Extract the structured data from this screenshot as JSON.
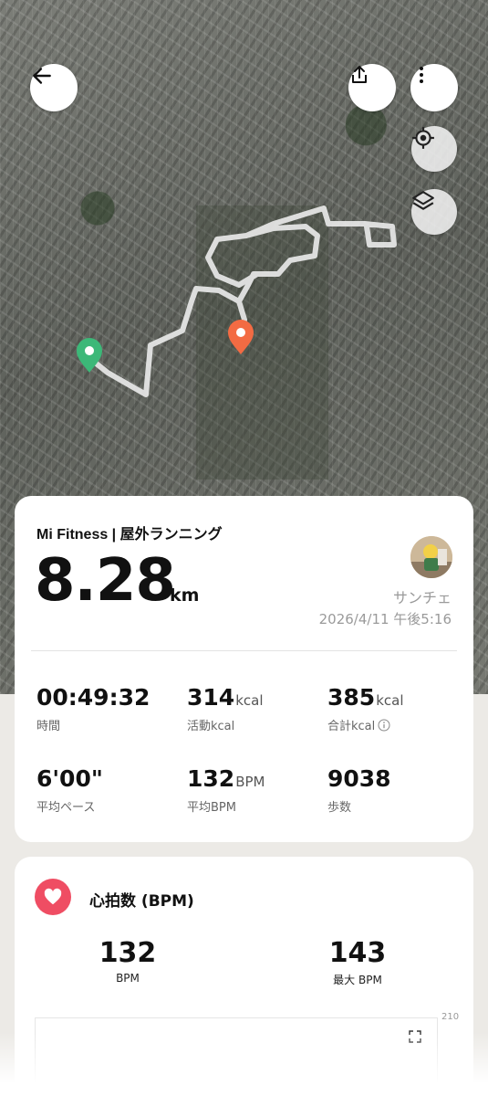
{
  "toolbar": {
    "back": "back-icon",
    "share": "share-icon",
    "more": "more-vertical-icon",
    "locate": "crosshair-icon",
    "layers": "layers-icon"
  },
  "map": {
    "route_color": "#e8e8e8",
    "start_marker_color": "#3cb878",
    "end_marker_color": "#f36b43"
  },
  "summary": {
    "source": "Mi Fitness | 屋外ランニング",
    "distance": "8.28",
    "distance_unit": "km",
    "username": "サンチェ",
    "datetime": "2026/4/11 午後5:16",
    "metrics": [
      {
        "value": "00:49:32",
        "unit": "",
        "label": "時間"
      },
      {
        "value": "314",
        "unit": "kcal",
        "label": "活動kcal"
      },
      {
        "value": "385",
        "unit": "kcal",
        "label": "合計kcal"
      },
      {
        "value": "6'00\"",
        "unit": "",
        "label": "平均ペース"
      },
      {
        "value": "132",
        "unit": "BPM",
        "label": "平均BPM"
      },
      {
        "value": "9038",
        "unit": "",
        "label": "歩数"
      }
    ]
  },
  "heart_rate": {
    "title": "心拍数 (BPM)",
    "avg_value": "132",
    "avg_label": "BPM",
    "max_value": "143",
    "max_label": "最大 BPM",
    "axis_max": "210",
    "accent": "#ef4d63"
  }
}
